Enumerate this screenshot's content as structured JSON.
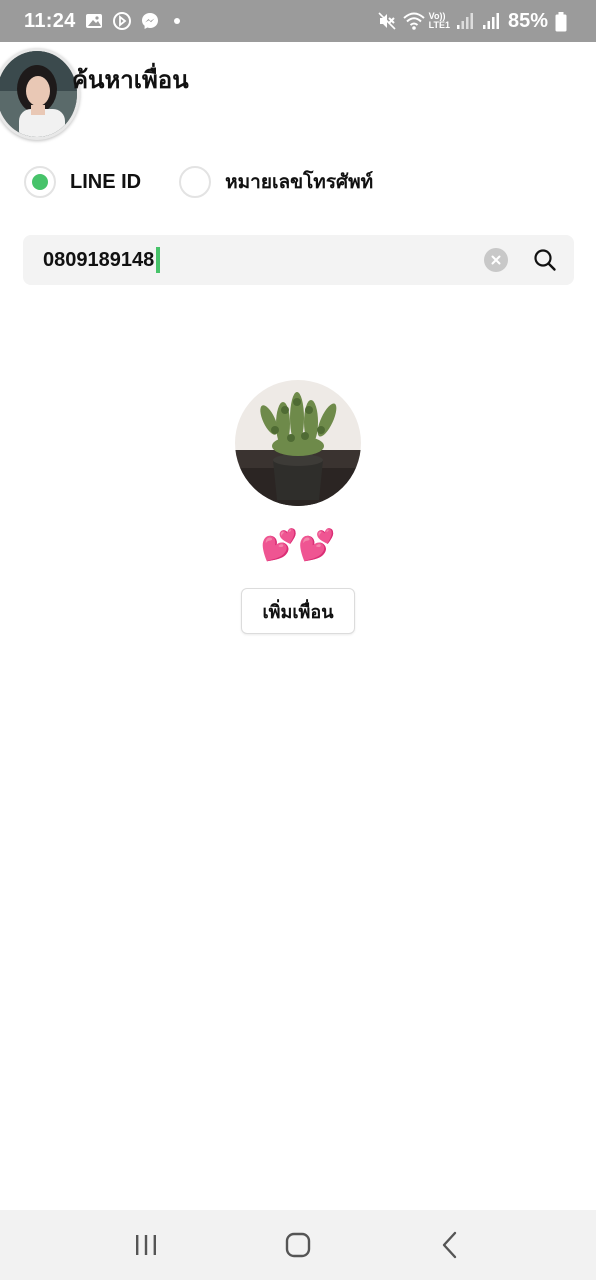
{
  "status_bar": {
    "time": "11:24",
    "battery": "85%",
    "network_label_top": "Vo))",
    "network_label_bottom": "LTE1",
    "left_icons": [
      "gallery-icon",
      "screen-recorder-icon",
      "messenger-icon",
      "notification-dot-icon"
    ],
    "right_icons": [
      "mute-icon",
      "wifi-icon",
      "signal-icon",
      "signal-icon",
      "battery-icon"
    ]
  },
  "header": {
    "title": "ค้นหาเพื่อน",
    "avatar_icon": "user-avatar"
  },
  "search_type": {
    "options": [
      {
        "label": "LINE ID",
        "selected": true
      },
      {
        "label": "หมายเลขโทรศัพท์",
        "selected": false
      }
    ]
  },
  "search": {
    "value": "0809189148",
    "clear_icon": "clear-icon",
    "search_icon": "search-icon"
  },
  "result": {
    "photo_icon": "profile-photo-plant",
    "display_name": "💕💕",
    "add_button_label": "เพิ่มเพื่อน"
  },
  "nav_bar": {
    "buttons": [
      "recent-apps-icon",
      "home-icon",
      "back-icon"
    ]
  },
  "colors": {
    "accent": "#47c36a",
    "status_bar_bg": "#9b9b9b",
    "search_bg": "#f3f3f3",
    "nav_bg": "#f2f2f2"
  }
}
